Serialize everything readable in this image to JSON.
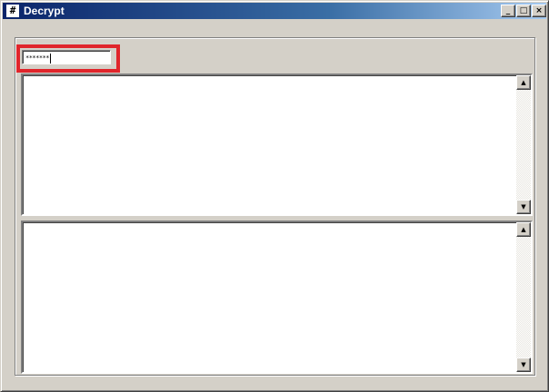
{
  "window": {
    "title": "Decrypt",
    "icon": "hash-app-icon",
    "controls": {
      "minimize_glyph": "_",
      "maximize_glyph": "□",
      "close_glyph": "×"
    }
  },
  "password_field": {
    "value": "*******"
  },
  "scroll_glyphs": {
    "up": "▲",
    "down": "▼"
  },
  "colors": {
    "titlebar_start": "#0a246a",
    "titlebar_end": "#a6caf0",
    "face": "#d4d0c8",
    "highlight_box": "#e0252b"
  }
}
